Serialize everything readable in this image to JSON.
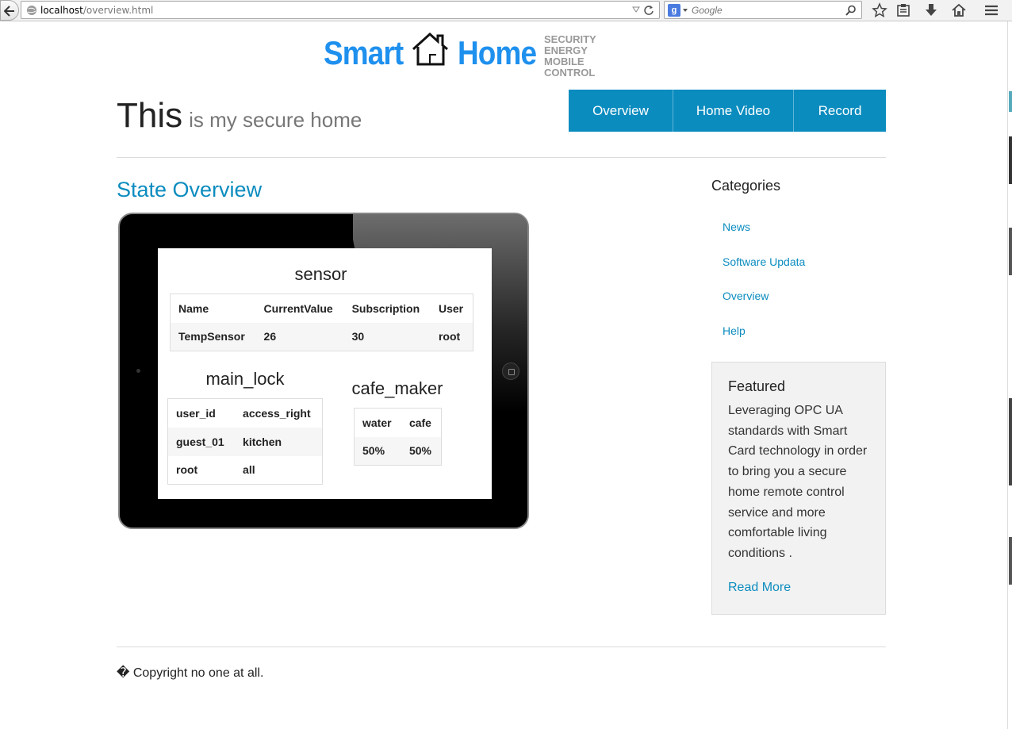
{
  "browser": {
    "url_host": "localhost",
    "url_path": "/overview.html",
    "search_engine": "Google"
  },
  "logo": {
    "word1": "Smart",
    "word2": "Home",
    "tagline": [
      "SECURITY",
      "ENERGY",
      "MOBILE CONTROL"
    ]
  },
  "headline": {
    "big": "This",
    "small": "is my secure home"
  },
  "nav": {
    "items": [
      {
        "label": "Overview"
      },
      {
        "label": "Home Video"
      },
      {
        "label": "Record"
      }
    ]
  },
  "main": {
    "title": "State Overview",
    "sensor": {
      "title": "sensor",
      "headers": [
        "Name",
        "CurrentValue",
        "Subscription",
        "User"
      ],
      "rows": [
        [
          "TempSensor",
          "26",
          "30",
          "root"
        ]
      ]
    },
    "main_lock": {
      "title": "main_lock",
      "headers": [
        "user_id",
        "access_right"
      ],
      "rows": [
        [
          "guest_01",
          "kitchen"
        ],
        [
          "root",
          "all"
        ]
      ]
    },
    "cafe_maker": {
      "title": "cafe_maker",
      "headers": [
        "water",
        "cafe"
      ],
      "rows": [
        [
          "50%",
          "50%"
        ]
      ]
    }
  },
  "sidebar": {
    "categories_title": "Categories",
    "links": [
      {
        "label": "News"
      },
      {
        "label": "Software Updata"
      },
      {
        "label": "Overview"
      },
      {
        "label": "Help"
      }
    ],
    "featured": {
      "title": "Featured",
      "body": "Leveraging OPC UA standards with Smart Card technology in order to bring you a secure home remote control service and more comfortable living conditions .",
      "more": "Read More"
    }
  },
  "footer": {
    "text": "� Copyright no one at all."
  },
  "colors": {
    "accent": "#0b8cbf",
    "logo_blue": "#1e90ee"
  }
}
